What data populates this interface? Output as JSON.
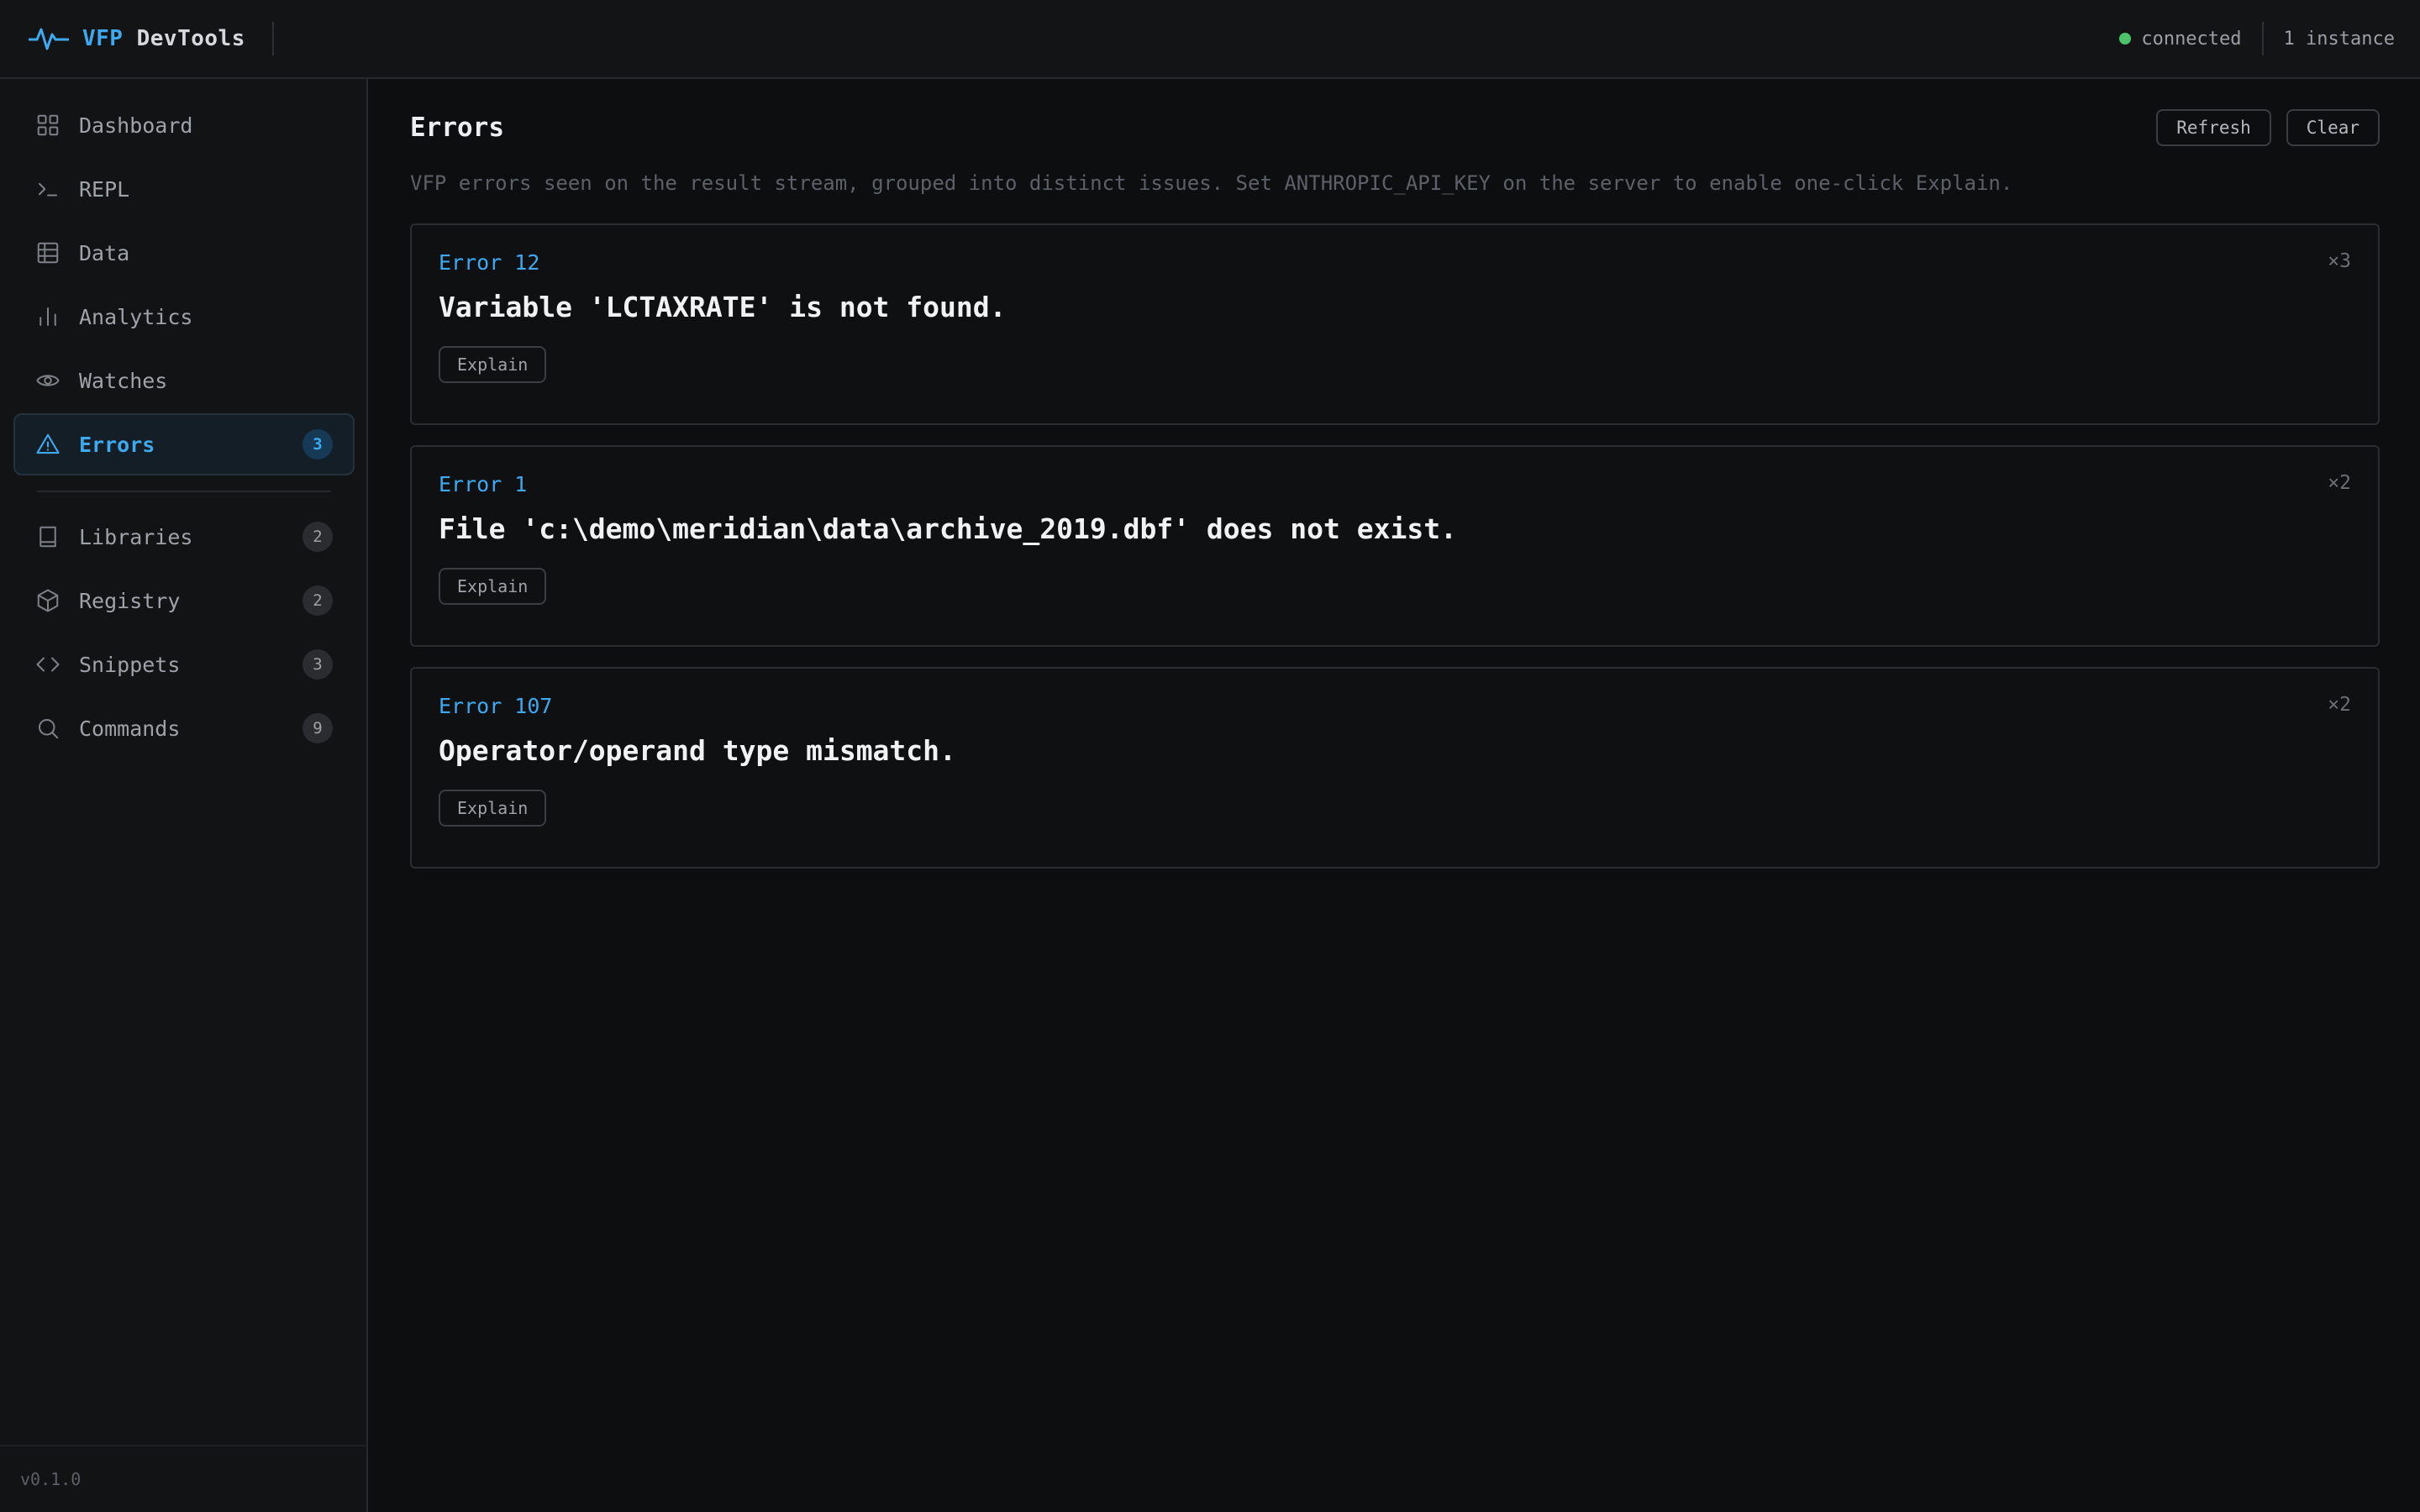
{
  "app": {
    "brand_accent": "VFP",
    "brand_rest": "DevTools",
    "accent_color": "#3fa9f0",
    "status_color": "#4cc36a",
    "status": "connected",
    "instances": "1 instance",
    "version": "v0.1.0"
  },
  "sidebar": {
    "items": [
      {
        "label": "Dashboard",
        "icon": "grid-icon"
      },
      {
        "label": "REPL",
        "icon": "terminal-icon"
      },
      {
        "label": "Data",
        "icon": "table-icon"
      },
      {
        "label": "Analytics",
        "icon": "bar-chart-icon"
      },
      {
        "label": "Watches",
        "icon": "eye-icon"
      },
      {
        "label": "Errors",
        "icon": "warning-triangle-icon",
        "badge": "3",
        "active": true
      },
      {
        "label": "Libraries",
        "icon": "book-icon",
        "badge": "2"
      },
      {
        "label": "Registry",
        "icon": "cube-icon",
        "badge": "2"
      },
      {
        "label": "Snippets",
        "icon": "code-brackets-icon",
        "badge": "3"
      },
      {
        "label": "Commands",
        "icon": "search-icon",
        "badge": "9"
      }
    ]
  },
  "main": {
    "title": "Errors",
    "refresh_label": "Refresh",
    "clear_label": "Clear",
    "description": "VFP errors seen on the result stream, grouped into distinct issues. Set ANTHROPIC_API_KEY on the server to enable one-click Explain.",
    "explain_label": "Explain",
    "errors": [
      {
        "code": "Error 12",
        "count": "×3",
        "message": "Variable 'LCTAXRATE' is not found."
      },
      {
        "code": "Error 1",
        "count": "×2",
        "message": "File 'c:\\demo\\meridian\\data\\archive_2019.dbf' does not exist."
      },
      {
        "code": "Error 107",
        "count": "×2",
        "message": "Operator/operand type mismatch."
      }
    ]
  }
}
